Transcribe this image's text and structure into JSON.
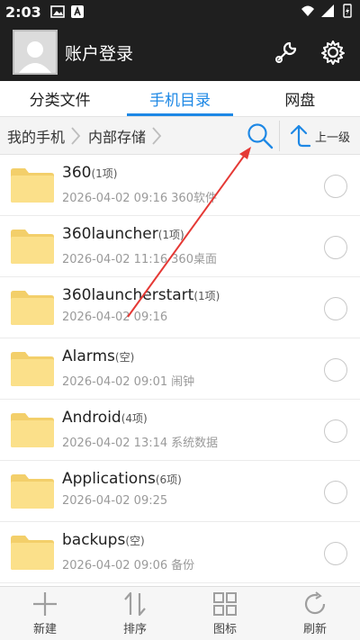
{
  "status_bar": {
    "time": "2:03"
  },
  "app_bar": {
    "title": "账户登录",
    "icons": [
      "avatar",
      "wrench-icon",
      "gear-icon"
    ]
  },
  "tabs": [
    {
      "label": "分类文件",
      "active": false
    },
    {
      "label": "手机目录",
      "active": true
    },
    {
      "label": "网盘",
      "active": false
    }
  ],
  "breadcrumb": {
    "items": [
      "我的手机",
      "内部存储"
    ],
    "up_label": "上一级"
  },
  "files": [
    {
      "name": "360",
      "count": "(1项)",
      "date": "2026-04-02 09:16",
      "tag": "360软件"
    },
    {
      "name": "360launcher",
      "count": "(1项)",
      "date": "2026-04-02 11:16",
      "tag": "360桌面"
    },
    {
      "name": "360launcherstart",
      "count": "(1项)",
      "date": "2026-04-02 09:16",
      "tag": ""
    },
    {
      "name": "Alarms",
      "count": "(空)",
      "date": "2026-04-02 09:01",
      "tag": "闹钟"
    },
    {
      "name": "Android",
      "count": "(4项)",
      "date": "2026-04-02 13:14",
      "tag": "系统数据"
    },
    {
      "name": "Applications",
      "count": "(6项)",
      "date": "2026-04-02 09:25",
      "tag": ""
    },
    {
      "name": "backups",
      "count": "(空)",
      "date": "2026-04-02 09:06",
      "tag": "备份"
    }
  ],
  "bottom_bar": [
    {
      "label": "新建",
      "icon": "plus-icon"
    },
    {
      "label": "排序",
      "icon": "sort-icon"
    },
    {
      "label": "图标",
      "icon": "grid-icon"
    },
    {
      "label": "刷新",
      "icon": "refresh-icon"
    }
  ],
  "colors": {
    "accent": "#1e88e5",
    "header": "#1f1f1f",
    "folder": "#fbe08a",
    "annotation": "#e53935"
  }
}
